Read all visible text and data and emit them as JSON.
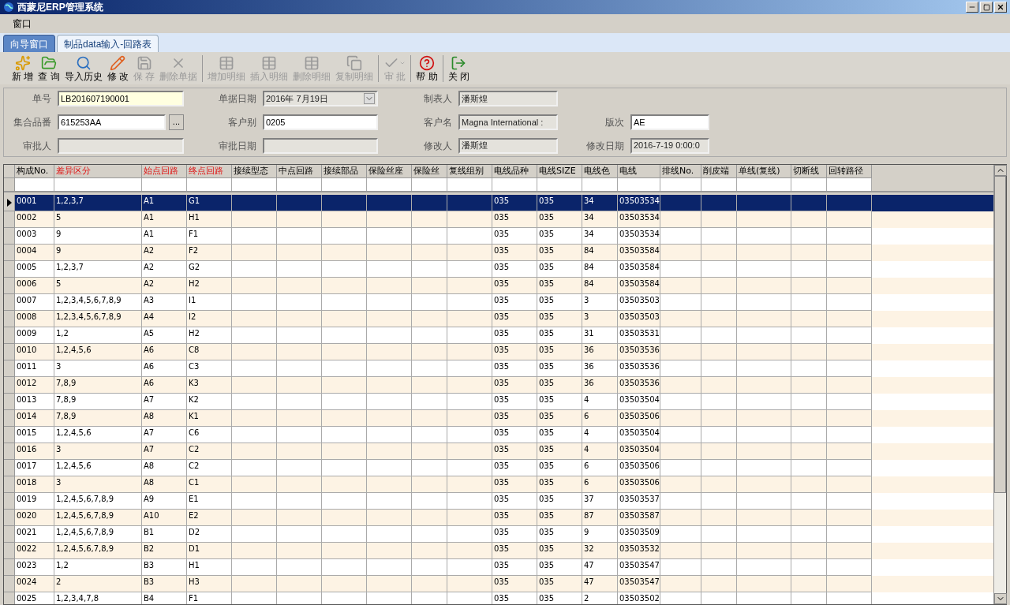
{
  "window": {
    "title": "西蒙尼ERP管理系统"
  },
  "menu": [
    "窗口"
  ],
  "tabs": [
    {
      "label": "向导窗口",
      "selected": false
    },
    {
      "label": "制品data输入-回路表",
      "selected": true
    }
  ],
  "toolbar": [
    {
      "label": "新 增",
      "disabled": false,
      "separator_before": false
    },
    {
      "label": "查 询",
      "disabled": false,
      "separator_before": false
    },
    {
      "label": "导入历史",
      "disabled": false,
      "separator_before": false
    },
    {
      "label": "修 改",
      "disabled": false,
      "separator_before": false
    },
    {
      "label": "保 存",
      "disabled": true,
      "separator_before": false
    },
    {
      "label": "删除单据",
      "disabled": true,
      "separator_before": false
    },
    {
      "label": "增加明细",
      "disabled": true,
      "separator_before": true
    },
    {
      "label": "插入明细",
      "disabled": true,
      "separator_before": false
    },
    {
      "label": "删除明细",
      "disabled": true,
      "separator_before": false
    },
    {
      "label": "复制明细",
      "disabled": true,
      "separator_before": false
    },
    {
      "label": "审 批",
      "disabled": true,
      "separator_before": true,
      "dropdown": true
    },
    {
      "label": "帮 助",
      "disabled": false,
      "separator_before": true
    },
    {
      "label": "关 闭",
      "disabled": false,
      "separator_before": true
    }
  ],
  "form": [
    {
      "label": "单号",
      "value": "LB201607190001",
      "kind": "text",
      "readonly": false,
      "highlighted": true
    },
    {
      "label": "单据日期",
      "value": "2016年 7月19日",
      "kind": "date",
      "readonly": true,
      "highlighted": false
    },
    {
      "label": "制表人",
      "value": "潘斯煌",
      "kind": "text",
      "readonly": true,
      "highlighted": false
    },
    {
      "kind": "blank"
    },
    {
      "label": "集合品番",
      "value": "615253AA",
      "kind": "lookup",
      "button": "...",
      "readonly": false,
      "highlighted": false
    },
    {
      "label": "客户别",
      "value": "0205",
      "kind": "text",
      "readonly": false,
      "highlighted": false
    },
    {
      "label": "客户名",
      "value": "Magna International :",
      "kind": "text",
      "readonly": true,
      "highlighted": false
    },
    {
      "label": "版次",
      "value": "AE",
      "kind": "text",
      "readonly": false,
      "highlighted": false
    },
    {
      "label": "审批人",
      "kind": "text",
      "readonly": true,
      "highlighted": false
    },
    {
      "label": "审批日期",
      "kind": "text",
      "readonly": true,
      "highlighted": false
    },
    {
      "label": "修改人",
      "value": "潘斯煌",
      "kind": "text",
      "readonly": true,
      "highlighted": false
    },
    {
      "label": "修改日期",
      "value": "2016-7-19 0:00:0",
      "kind": "text",
      "readonly": true,
      "highlighted": false
    }
  ],
  "table": {
    "columns": [
      {
        "label": "构成No.",
        "required": false
      },
      {
        "label": "差异区分",
        "required": true
      },
      {
        "label": "始点回路",
        "required": true
      },
      {
        "label": "终点回路",
        "required": true
      },
      {
        "label": "接续型态",
        "required": false
      },
      {
        "label": "中点回路",
        "required": false
      },
      {
        "label": "接续部品",
        "required": false
      },
      {
        "label": "保险丝座",
        "required": false
      },
      {
        "label": "保险丝",
        "required": false
      },
      {
        "label": "复线组别",
        "required": false
      },
      {
        "label": "电线品种",
        "required": false
      },
      {
        "label": "电线SIZE",
        "required": false
      },
      {
        "label": "电线色",
        "required": false
      },
      {
        "label": "电线",
        "required": false
      },
      {
        "label": "排线No.",
        "required": false
      },
      {
        "label": "削皮端",
        "required": false
      },
      {
        "label": "单线(复线)",
        "required": false
      },
      {
        "label": "切断线",
        "required": false
      },
      {
        "label": "回转路径",
        "required": false
      }
    ],
    "rows": [
      {
        "no": "0001",
        "diff": "1,2,3,7",
        "start": "A1",
        "end": "G1",
        "wire_kind": "035",
        "wire_size": "035",
        "wire_color": "34",
        "wire": "03503534",
        "selected": true
      },
      {
        "no": "0002",
        "diff": "5",
        "start": "A1",
        "end": "H1",
        "wire_kind": "035",
        "wire_size": "035",
        "wire_color": "34",
        "wire": "03503534",
        "selected": false
      },
      {
        "no": "0003",
        "diff": "9",
        "start": "A1",
        "end": "F1",
        "wire_kind": "035",
        "wire_size": "035",
        "wire_color": "34",
        "wire": "03503534",
        "selected": false
      },
      {
        "no": "0004",
        "diff": "9",
        "start": "A2",
        "end": "F2",
        "wire_kind": "035",
        "wire_size": "035",
        "wire_color": "84",
        "wire": "03503584",
        "selected": false
      },
      {
        "no": "0005",
        "diff": "1,2,3,7",
        "start": "A2",
        "end": "G2",
        "wire_kind": "035",
        "wire_size": "035",
        "wire_color": "84",
        "wire": "03503584",
        "selected": false
      },
      {
        "no": "0006",
        "diff": "5",
        "start": "A2",
        "end": "H2",
        "wire_kind": "035",
        "wire_size": "035",
        "wire_color": "84",
        "wire": "03503584",
        "selected": false
      },
      {
        "no": "0007",
        "diff": "1,2,3,4,5,6,7,8,9",
        "start": "A3",
        "end": "I1",
        "wire_kind": "035",
        "wire_size": "035",
        "wire_color": "3",
        "wire": "03503503",
        "selected": false
      },
      {
        "no": "0008",
        "diff": "1,2,3,4,5,6,7,8,9",
        "start": "A4",
        "end": "I2",
        "wire_kind": "035",
        "wire_size": "035",
        "wire_color": "3",
        "wire": "03503503",
        "selected": false
      },
      {
        "no": "0009",
        "diff": "1,2",
        "start": "A5",
        "end": "H2",
        "wire_kind": "035",
        "wire_size": "035",
        "wire_color": "31",
        "wire": "03503531",
        "selected": false
      },
      {
        "no": "0010",
        "diff": "1,2,4,5,6",
        "start": "A6",
        "end": "C8",
        "wire_kind": "035",
        "wire_size": "035",
        "wire_color": "36",
        "wire": "03503536",
        "selected": false
      },
      {
        "no": "0011",
        "diff": "3",
        "start": "A6",
        "end": "C3",
        "wire_kind": "035",
        "wire_size": "035",
        "wire_color": "36",
        "wire": "03503536",
        "selected": false
      },
      {
        "no": "0012",
        "diff": "7,8,9",
        "start": "A6",
        "end": "K3",
        "wire_kind": "035",
        "wire_size": "035",
        "wire_color": "36",
        "wire": "03503536",
        "selected": false
      },
      {
        "no": "0013",
        "diff": "7,8,9",
        "start": "A7",
        "end": "K2",
        "wire_kind": "035",
        "wire_size": "035",
        "wire_color": "4",
        "wire": "03503504",
        "selected": false
      },
      {
        "no": "0014",
        "diff": "7,8,9",
        "start": "A8",
        "end": "K1",
        "wire_kind": "035",
        "wire_size": "035",
        "wire_color": "6",
        "wire": "03503506",
        "selected": false
      },
      {
        "no": "0015",
        "diff": "1,2,4,5,6",
        "start": "A7",
        "end": "C6",
        "wire_kind": "035",
        "wire_size": "035",
        "wire_color": "4",
        "wire": "03503504",
        "selected": false
      },
      {
        "no": "0016",
        "diff": "3",
        "start": "A7",
        "end": "C2",
        "wire_kind": "035",
        "wire_size": "035",
        "wire_color": "4",
        "wire": "03503504",
        "selected": false
      },
      {
        "no": "0017",
        "diff": "1,2,4,5,6",
        "start": "A8",
        "end": "C2",
        "wire_kind": "035",
        "wire_size": "035",
        "wire_color": "6",
        "wire": "03503506",
        "selected": false
      },
      {
        "no": "0018",
        "diff": "3",
        "start": "A8",
        "end": "C1",
        "wire_kind": "035",
        "wire_size": "035",
        "wire_color": "6",
        "wire": "03503506",
        "selected": false
      },
      {
        "no": "0019",
        "diff": "1,2,4,5,6,7,8,9",
        "start": "A9",
        "end": "E1",
        "wire_kind": "035",
        "wire_size": "035",
        "wire_color": "37",
        "wire": "03503537",
        "selected": false
      },
      {
        "no": "0020",
        "diff": "1,2,4,5,6,7,8,9",
        "start": "A10",
        "end": "E2",
        "wire_kind": "035",
        "wire_size": "035",
        "wire_color": "87",
        "wire": "03503587",
        "selected": false
      },
      {
        "no": "0021",
        "diff": "1,2,4,5,6,7,8,9",
        "start": "B1",
        "end": "D2",
        "wire_kind": "035",
        "wire_size": "035",
        "wire_color": "9",
        "wire": "03503509",
        "selected": false
      },
      {
        "no": "0022",
        "diff": "1,2,4,5,6,7,8,9",
        "start": "B2",
        "end": "D1",
        "wire_kind": "035",
        "wire_size": "035",
        "wire_color": "32",
        "wire": "03503532",
        "selected": false
      },
      {
        "no": "0023",
        "diff": "1,2",
        "start": "B3",
        "end": "H1",
        "wire_kind": "035",
        "wire_size": "035",
        "wire_color": "47",
        "wire": "03503547",
        "selected": false
      },
      {
        "no": "0024",
        "diff": "2",
        "start": "B3",
        "end": "H3",
        "wire_kind": "035",
        "wire_size": "035",
        "wire_color": "47",
        "wire": "03503547",
        "selected": false
      },
      {
        "no": "0025",
        "diff": "1,2,3,4,7,8",
        "start": "B4",
        "end": "F1",
        "wire_kind": "035",
        "wire_size": "035",
        "wire_color": "2",
        "wire": "03503502",
        "selected": false
      }
    ]
  }
}
